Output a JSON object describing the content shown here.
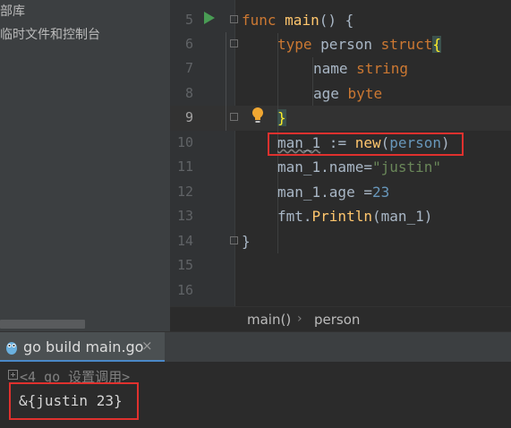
{
  "project_tree": {
    "items": [
      "部库",
      "临时文件和控制台"
    ]
  },
  "editor": {
    "line_numbers": [
      "5",
      "6",
      "7",
      "8",
      "9",
      "10",
      "11",
      "12",
      "13",
      "14",
      "15",
      "16"
    ],
    "lines": {
      "l5": {
        "kw": "func",
        "name": "main",
        "rest": "() {"
      },
      "l6": {
        "kw": "type",
        "name": "person",
        "kw2": "struct",
        "brace": "{"
      },
      "l7": {
        "field": "name",
        "type": "string"
      },
      "l8": {
        "field": "age",
        "type": "byte"
      },
      "l9": {
        "brace": "}"
      },
      "l10": {
        "var": "man_1",
        "op": " := ",
        "fn": "new",
        "open": "(",
        "arg": "person",
        "close": ")"
      },
      "l11": {
        "text": "man_1.name=",
        "str": "\"justin\""
      },
      "l12": {
        "text": "man_1.age =",
        "num": "23"
      },
      "l13": {
        "pkg": "fmt.",
        "fn": "Println",
        "args": "(man_1)"
      },
      "l14": {
        "text": "}"
      }
    }
  },
  "breadcrumb": {
    "items": [
      "main()",
      "person"
    ],
    "separator": "›"
  },
  "run_panel": {
    "tab_label": "go build main.go",
    "close_glyph": "×",
    "collapsed_line": "<4 go 设置调用>",
    "output": "&{justin 23}"
  },
  "colors": {
    "keyword": "#cc7832",
    "function": "#ffc66d",
    "string": "#6a8759",
    "number": "#6897bb",
    "highlight_box": "#e0312e"
  }
}
